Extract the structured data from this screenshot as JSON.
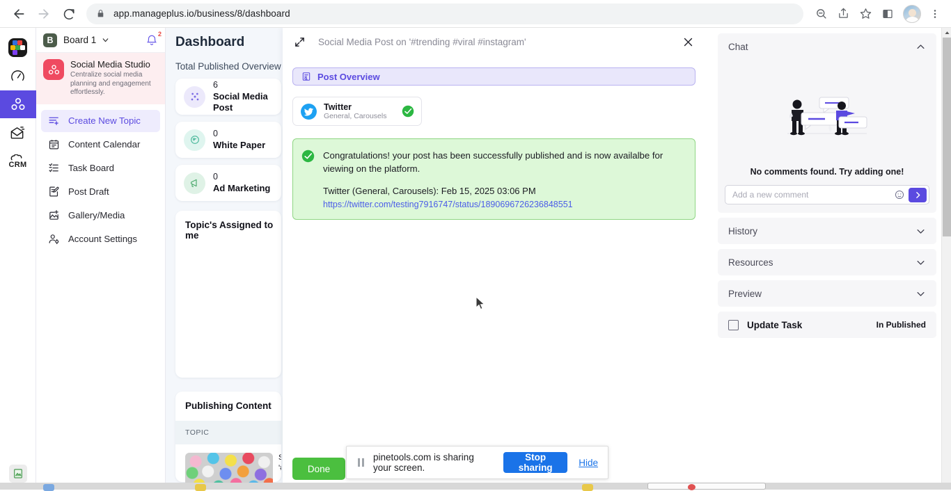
{
  "browser": {
    "url": "app.manageplus.io/business/8/dashboard",
    "back_icon": "back-arrow-icon",
    "forward_icon": "forward-arrow-icon",
    "reload_icon": "reload-icon",
    "lock_icon": "lock-icon",
    "zoom_icon": "zoom-out-icon",
    "share_icon": "share-icon",
    "bookmark_icon": "star-icon",
    "sidepanel_icon": "side-panel-icon",
    "profile_icon": "profile-avatar",
    "menu_icon": "three-dot-menu-icon"
  },
  "rail": {
    "items": [
      {
        "name": "apps-logo",
        "label": ""
      },
      {
        "name": "speedometer-icon",
        "label": ""
      },
      {
        "name": "social-studio-icon",
        "label": ""
      },
      {
        "name": "email-campaign-icon",
        "label": ""
      },
      {
        "name": "crm-icon",
        "label": "CRM"
      }
    ],
    "bottom_icon": "image-file-icon"
  },
  "sidebar": {
    "board": {
      "avatar_letter": "B",
      "name": "Board 1",
      "chevron_icon": "chevron-down-icon",
      "bell_icon": "notification-bell-icon",
      "bell_badge": "2"
    },
    "promo": {
      "icon": "social-studio-icon",
      "title": "Social Media Studio",
      "subtitle": "Centralize social media planning and engagement effortlessly."
    },
    "items": [
      {
        "label": "Create New Topic",
        "icon": "create-topic-icon",
        "active": true
      },
      {
        "label": "Content Calendar",
        "icon": "calendar-icon",
        "active": false
      },
      {
        "label": "Task Board",
        "icon": "task-list-icon",
        "active": false
      },
      {
        "label": "Post Draft",
        "icon": "draft-edit-icon",
        "active": false
      },
      {
        "label": "Gallery/Media",
        "icon": "gallery-add-icon",
        "active": false
      },
      {
        "label": "Account Settings",
        "icon": "account-settings-icon",
        "active": false
      }
    ]
  },
  "dashboard": {
    "title": "Dashboard",
    "subtitle": "Total Published Overview",
    "stats": [
      {
        "count": "6",
        "label": "Social Media Post",
        "icon": "share-nodes-icon",
        "bg": "#ece9fb",
        "fg": "#7a6ae4"
      },
      {
        "count": "0",
        "label": "White Paper",
        "icon": "document-swirl-icon",
        "bg": "#dff5ef",
        "fg": "#49b79a"
      },
      {
        "count": "0",
        "label": "Ad Marketing",
        "icon": "megaphone-icon",
        "bg": "#dff2e6",
        "fg": "#4aa96c"
      }
    ],
    "assigned_panel_title": "Topic's Assigned to me",
    "publishing": {
      "title": "Publishing Content",
      "column_header": "TOPIC",
      "row": {
        "line1": "Soc",
        "line2": "'#tr",
        "thumb_icon": "beads-photo-thumbnail"
      }
    }
  },
  "modal": {
    "expand_icon": "expand-arrows-icon",
    "title": "Social Media Post on '#trending #viral #instagram'",
    "close_icon": "close-x-icon",
    "tab": {
      "label": "Post Overview",
      "icon": "post-overview-icon"
    },
    "channel": {
      "platform": "Twitter",
      "sub": "General, Carousels",
      "icon": "twitter-bird-icon",
      "status_icon": "check-circle-green-icon"
    },
    "success": {
      "icon": "check-circle-green-icon",
      "message": "Congratulations! your post has been successfully published and is now availalbe for viewing on the platform.",
      "meta": "Twitter (General, Carousels): Feb 15, 2025 03:06 PM",
      "link": "https://twitter.com/testing7916747/status/1890696726236848551"
    },
    "done_label": "Done"
  },
  "chat": {
    "header": {
      "label": "Chat",
      "chevron": "chevron-up-icon"
    },
    "empty_message": "No comments found. Try adding one!",
    "input_placeholder": "Add a new comment",
    "emoji_icon": "emoji-smiley-icon",
    "send_icon": "send-arrow-icon",
    "illustration": "two-people-chat-bubbles-illustration",
    "sections": [
      {
        "label": "History",
        "chevron": "chevron-down-icon"
      },
      {
        "label": "Resources",
        "chevron": "chevron-down-icon"
      },
      {
        "label": "Preview",
        "chevron": "chevron-down-icon"
      }
    ],
    "task": {
      "label": "Update Task",
      "status": "In Published",
      "checkbox": "unchecked-checkbox"
    }
  },
  "share_notice": {
    "pause_icon": "pause-icon",
    "text": "pinetools.com is sharing your screen.",
    "stop_label": "Stop sharing",
    "hide_label": "Hide"
  },
  "colors": {
    "accent": "#5b4ae0",
    "success": "#4bbf3f",
    "link": "#1a73e8",
    "promo_bg": "#fdeef0"
  }
}
